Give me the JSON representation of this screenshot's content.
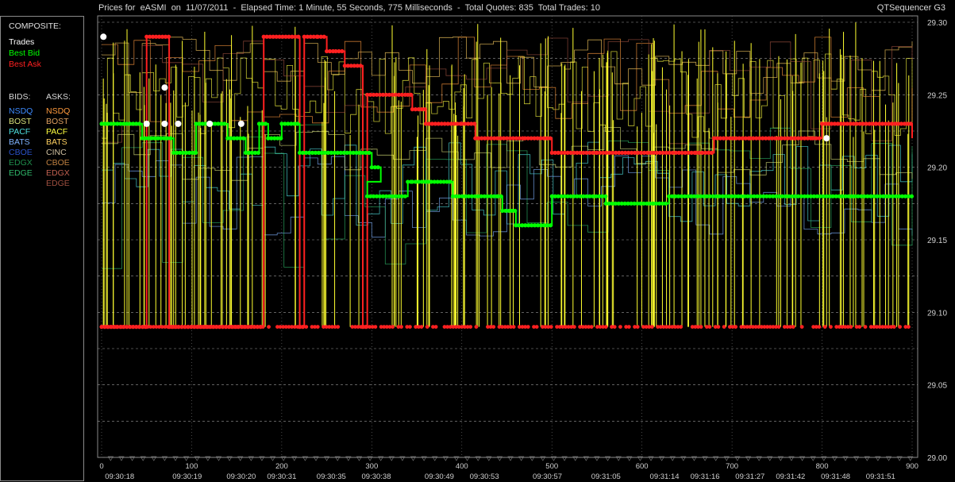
{
  "window": {
    "title": "Prices for  eASMI  on  11/07/2011  -  Elapsed Time: 1 Minute, 55 Seconds, 775 Milliseconds  -  Total Quotes: 835  Total Trades: 10",
    "app_name": "QTSequencer G3"
  },
  "legend": {
    "composite_header": "COMPOSITE:",
    "composite": [
      {
        "label": "Trades",
        "color": "#ffffff"
      },
      {
        "label": "Best Bid",
        "color": "#00ff00"
      },
      {
        "label": "Best Ask",
        "color": "#ff2020"
      }
    ],
    "bids_header": "BIDS:",
    "asks_header": "ASKS:",
    "bids": [
      {
        "label": "NSDQ",
        "color": "#3d8bff"
      },
      {
        "label": "BOST",
        "color": "#d9e27a"
      },
      {
        "label": "PACF",
        "color": "#4ee0e0"
      },
      {
        "label": "BATS",
        "color": "#7fb2ff"
      },
      {
        "label": "CBOE",
        "color": "#2a52c9"
      },
      {
        "label": "EDGX",
        "color": "#1f8f4c"
      },
      {
        "label": "EDGE",
        "color": "#2fb86a"
      }
    ],
    "asks": [
      {
        "label": "NSDQ",
        "color": "#ff9a3d"
      },
      {
        "label": "BOST",
        "color": "#e0a060"
      },
      {
        "label": "PACF",
        "color": "#ffff40"
      },
      {
        "label": "BATS",
        "color": "#ffd060"
      },
      {
        "label": "CINC",
        "color": "#d0c0a0"
      },
      {
        "label": "CBOE",
        "color": "#c08040"
      },
      {
        "label": "EDGX",
        "color": "#c06050"
      },
      {
        "label": "EDGE",
        "color": "#a05040"
      }
    ]
  },
  "chart_data": {
    "type": "line",
    "ylim": [
      29.0,
      29.3
    ],
    "xlim": [
      0,
      900
    ],
    "y_ticks": [
      "29.00",
      "29.05",
      "29.10",
      "29.15",
      "29.20",
      "29.25",
      "29.30"
    ],
    "x_ticks": [
      0,
      100,
      200,
      300,
      400,
      500,
      600,
      700,
      800,
      900
    ],
    "time_labels": [
      {
        "q": 20,
        "t": "09:30:18"
      },
      {
        "q": 95,
        "t": "09:30:19"
      },
      {
        "q": 155,
        "t": "09:30:20"
      },
      {
        "q": 200,
        "t": "09:30:31"
      },
      {
        "q": 255,
        "t": "09:30:35"
      },
      {
        "q": 305,
        "t": "09:30:38"
      },
      {
        "q": 375,
        "t": "09:30:49"
      },
      {
        "q": 425,
        "t": "09:30:53"
      },
      {
        "q": 495,
        "t": "09:30:57"
      },
      {
        "q": 560,
        "t": "09:31:05"
      },
      {
        "q": 625,
        "t": "09:31:14"
      },
      {
        "q": 670,
        "t": "09:31:16"
      },
      {
        "q": 720,
        "t": "09:31:27"
      },
      {
        "q": 765,
        "t": "09:31:42"
      },
      {
        "q": 815,
        "t": "09:31:48"
      },
      {
        "q": 865,
        "t": "09:31:51"
      }
    ],
    "series": [
      {
        "name": "Trades",
        "color": "#ffffff",
        "points": [
          [
            2,
            29.29
          ],
          [
            70,
            29.255
          ],
          [
            50,
            29.23
          ],
          [
            70,
            29.23
          ],
          [
            85,
            29.23
          ],
          [
            120,
            29.23
          ],
          [
            155,
            29.23
          ],
          [
            805,
            29.22
          ]
        ]
      },
      {
        "name": "Best Bid",
        "color": "#00ff00",
        "steps": [
          [
            0,
            29.23
          ],
          [
            45,
            29.22
          ],
          [
            80,
            29.21
          ],
          [
            105,
            29.23
          ],
          [
            140,
            29.22
          ],
          [
            160,
            29.21
          ],
          [
            175,
            29.23
          ],
          [
            185,
            29.22
          ],
          [
            200,
            29.23
          ],
          [
            220,
            29.21
          ],
          [
            300,
            29.2
          ],
          [
            310,
            29.19
          ],
          [
            295,
            29.18
          ],
          [
            340,
            29.19
          ],
          [
            345,
            29.19
          ],
          [
            390,
            29.18
          ],
          [
            440,
            29.18
          ],
          [
            445,
            29.17
          ],
          [
            460,
            29.16
          ],
          [
            500,
            29.18
          ],
          [
            560,
            29.18
          ],
          [
            560,
            29.175
          ],
          [
            630,
            29.175
          ],
          [
            630,
            29.18
          ],
          [
            900,
            29.18
          ]
        ]
      },
      {
        "name": "Best Ask",
        "color": "#ff2020",
        "steps": [
          [
            0,
            29.09
          ],
          [
            50,
            29.29
          ],
          [
            75,
            29.09
          ],
          [
            180,
            29.29
          ],
          [
            215,
            29.29
          ],
          [
            220,
            29.09
          ],
          [
            225,
            29.29
          ],
          [
            240,
            29.29
          ],
          [
            250,
            29.28
          ],
          [
            260,
            29.28
          ],
          [
            270,
            29.27
          ],
          [
            290,
            29.09
          ],
          [
            295,
            29.25
          ],
          [
            330,
            29.25
          ],
          [
            340,
            29.25
          ],
          [
            345,
            29.24
          ],
          [
            360,
            29.23
          ],
          [
            400,
            29.23
          ],
          [
            415,
            29.22
          ],
          [
            450,
            29.22
          ],
          [
            470,
            29.22
          ],
          [
            500,
            29.21
          ],
          [
            550,
            29.21
          ],
          [
            620,
            29.21
          ],
          [
            660,
            29.21
          ],
          [
            680,
            29.22
          ],
          [
            720,
            29.22
          ],
          [
            770,
            29.22
          ],
          [
            790,
            29.22
          ],
          [
            800,
            29.23
          ],
          [
            860,
            29.23
          ],
          [
            900,
            29.22
          ]
        ]
      }
    ]
  }
}
